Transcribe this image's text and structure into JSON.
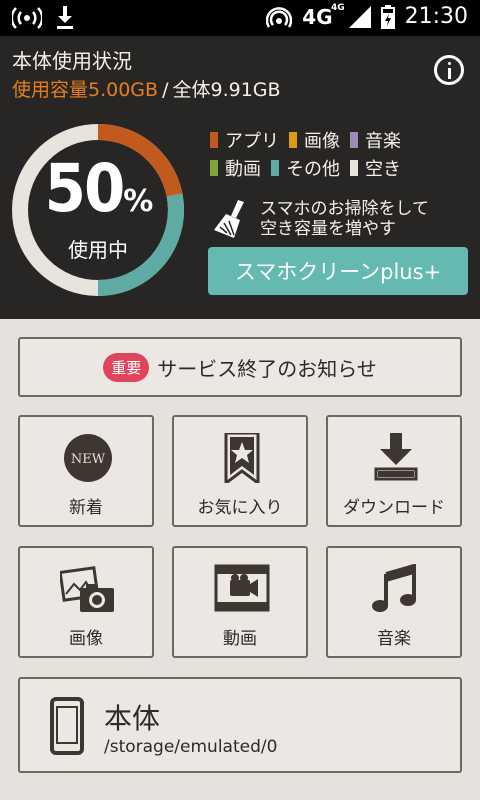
{
  "status_bar": {
    "network": "4G",
    "network_sup": "4G",
    "time": "21:30"
  },
  "header": {
    "title": "本体使用状況",
    "used_label": "使用容量5.00GB",
    "separator": "/",
    "total_label": "全体9.91GB",
    "percent_number": "50",
    "percent_unit": "%",
    "percent_caption": "使用中",
    "usage_ratio": 0.5,
    "legend": [
      {
        "label": "アプリ",
        "color": "#c35a1d"
      },
      {
        "label": "画像",
        "color": "#e0981b"
      },
      {
        "label": "音楽",
        "color": "#9e8cb8"
      },
      {
        "label": "動画",
        "color": "#7ea43a"
      },
      {
        "label": "その他",
        "color": "#5faaa2"
      },
      {
        "label": "空き",
        "color": "#e8e3dd"
      }
    ],
    "clean_note_line1": "スマホのお掃除をして",
    "clean_note_line2": "空き容量を増やす",
    "clean_button": "スマホクリーンplus+",
    "info_icon": "info-icon"
  },
  "notice": {
    "badge": "重要",
    "text": "サービス終了のお知らせ"
  },
  "tiles": [
    {
      "label": "新着",
      "icon": "new-icon"
    },
    {
      "label": "お気に入り",
      "icon": "bookmark-star-icon"
    },
    {
      "label": "ダウンロード",
      "icon": "download-icon"
    },
    {
      "label": "画像",
      "icon": "photo-camera-icon"
    },
    {
      "label": "動画",
      "icon": "video-film-icon"
    },
    {
      "label": "音楽",
      "icon": "music-note-icon"
    }
  ],
  "new_icon_text": "NEW",
  "storage": {
    "name": "本体",
    "path": "/storage/emulated/0"
  },
  "colors": {
    "accent_orange": "#e77e1c",
    "teal": "#64bab0",
    "badge_red": "#e0455e"
  }
}
